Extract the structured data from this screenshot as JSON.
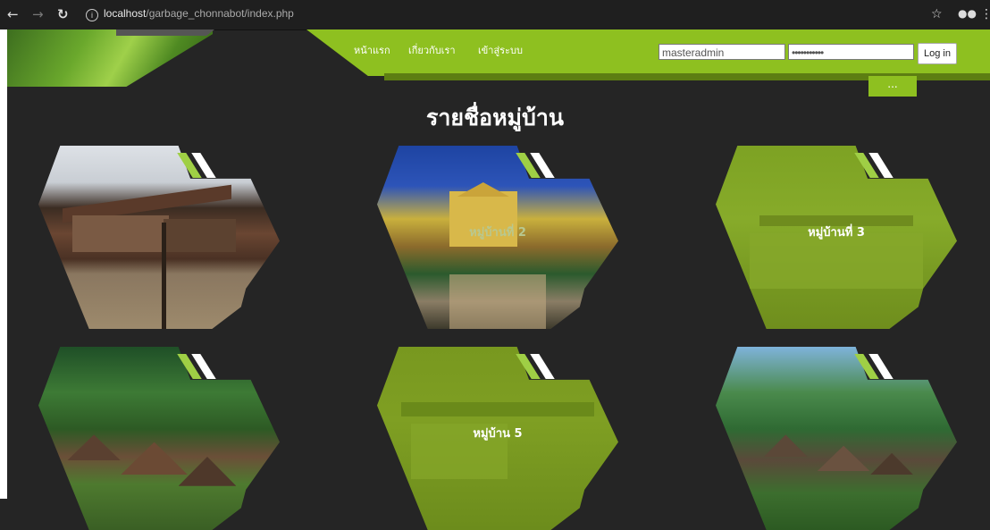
{
  "browser": {
    "url_host": "localhost",
    "url_path": "/garbage_chonnabot/index.php"
  },
  "nav": {
    "items": [
      "หน้าแรก",
      "เกี่ยวกับเรา",
      "เข้าสู่ระบบ"
    ]
  },
  "login": {
    "username_value": "masteradmin",
    "password_value": "•••••••••••",
    "button_label": "Log in"
  },
  "menu_tab_label": "...",
  "page_title": "รายชื่อหมู่บ้าน",
  "villages": [
    {
      "label": ""
    },
    {
      "label": "หมู่บ้านที่ 2"
    },
    {
      "label": "หมู่บ้านที่ 3"
    },
    {
      "label": ""
    },
    {
      "label": "หมู่บ้าน 5"
    },
    {
      "label": ""
    }
  ],
  "colors": {
    "accent_green": "#8ec020",
    "background": "#252525"
  }
}
